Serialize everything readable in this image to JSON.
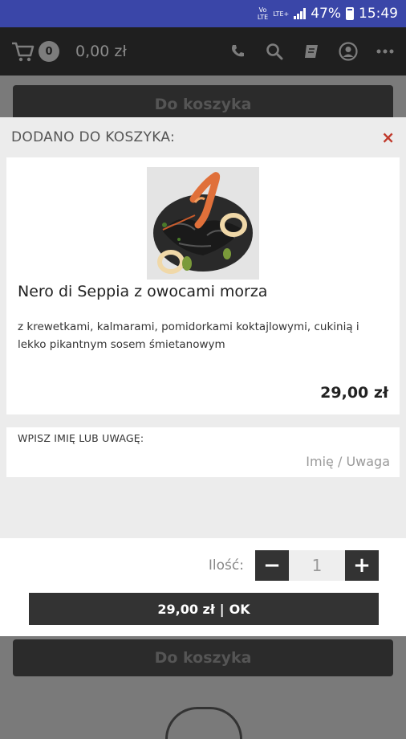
{
  "status_bar": {
    "volte": "VoLTE",
    "lte": "LTE+",
    "battery": "47%",
    "time": "15:49"
  },
  "app_bar": {
    "cart_count": "0",
    "cart_total": "0,00 zł",
    "icons": [
      "cart-icon",
      "phone-icon",
      "search-icon",
      "menu-book-icon",
      "account-icon",
      "more-icon"
    ]
  },
  "background": {
    "cart_button_label": "Do koszyka"
  },
  "modal": {
    "title": "DODANO DO KOSZYKA:",
    "close": "×",
    "product": {
      "name": "Nero di Seppia z owocami morza",
      "description": "z krewetkami, kalmarami, pomidorkami koktajlowymi, cukinią i lekko pikantnym sosem śmietanowym",
      "price": "29,00 zł"
    },
    "note": {
      "label": "WPISZ IMIĘ LUB UWAGĘ:",
      "placeholder": "Imię / Uwaga",
      "value": ""
    },
    "quantity": {
      "label": "Ilość:",
      "value": "1",
      "minus": "−",
      "plus": "+"
    },
    "confirm": {
      "price": "29,00 zł",
      "separator": "|",
      "label": "OK"
    }
  },
  "colors": {
    "status_bar": "#3a46a8",
    "accent_close": "#c0392b",
    "dark_button": "#333333"
  }
}
